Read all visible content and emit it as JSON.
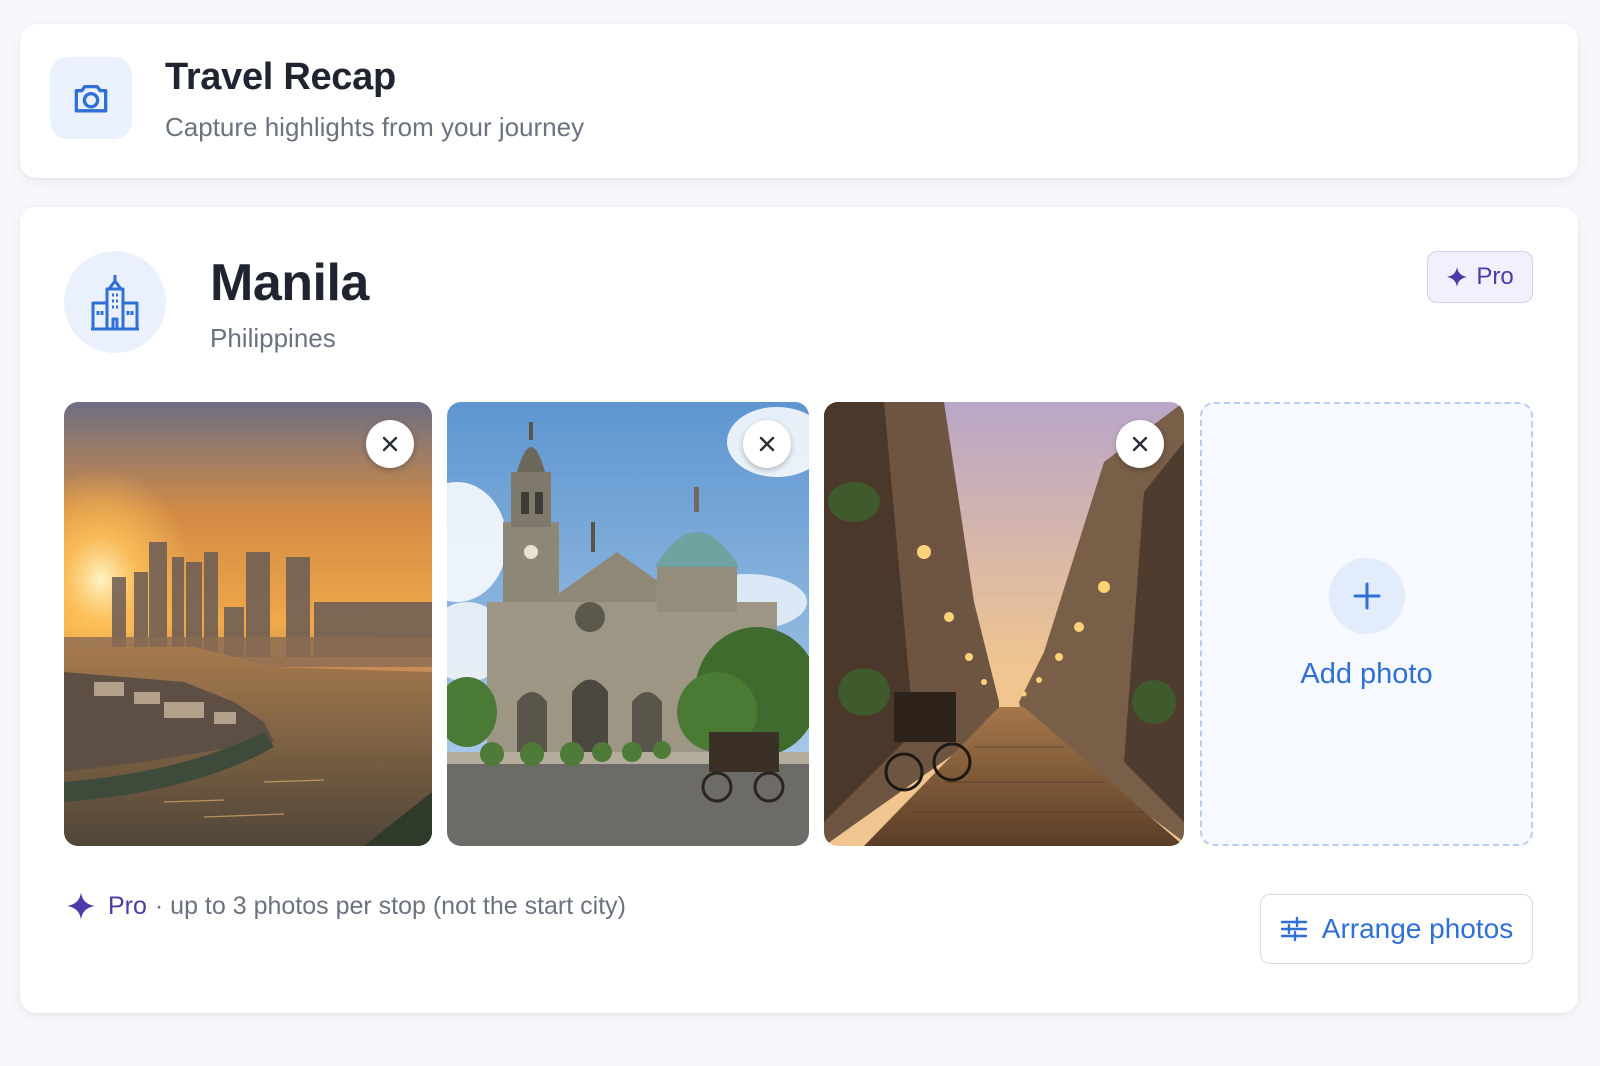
{
  "header": {
    "title": "Travel Recap",
    "subtitle": "Capture highlights from your journey",
    "icon": "camera-icon"
  },
  "stop": {
    "city": "Manila",
    "country": "Philippines",
    "icon": "city-hall-icon",
    "badge": {
      "label": "Pro",
      "icon": "sparkle-icon"
    }
  },
  "photos": [
    {
      "subject": "sunset-skyline-river",
      "remove_icon": "close-icon"
    },
    {
      "subject": "cathedral-dome",
      "remove_icon": "close-icon"
    },
    {
      "subject": "lantern-street-carriage",
      "remove_icon": "close-icon"
    }
  ],
  "add_photo": {
    "label": "Add photo",
    "icon": "plus-icon"
  },
  "footer": {
    "pro_label": "Pro",
    "note": "· up to 3 photos per stop (not the start city)",
    "arrange_label": "Arrange photos",
    "arrange_icon": "sliders-icon"
  },
  "colors": {
    "accent": "#2f6fd6",
    "pro": "#4c3aa8",
    "muted": "#6b7280",
    "background": "#f7f8fb"
  }
}
